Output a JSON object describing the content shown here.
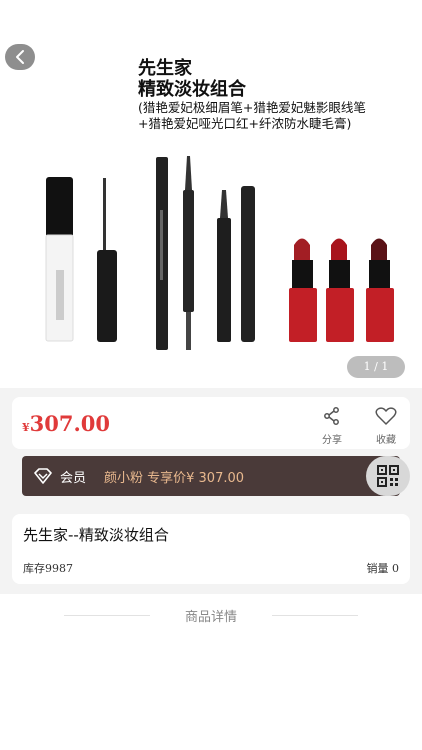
{
  "hero": {
    "title_line1": "先生家",
    "title_line2": "精致淡妆组合",
    "subtitle_line1": "(猎艳爱妃极细眉笔+猎艳爱妃魅影眼线笔",
    "subtitle_line2": "+猎艳爱妃哑光口红+纤浓防水睫毛膏)",
    "pager": "1 / 1"
  },
  "price": {
    "currency": "¥",
    "value": "307.00",
    "share_label": "分享",
    "favorite_label": "收藏"
  },
  "member": {
    "label": "会员",
    "price_text": "颜小粉 专享价¥ 307.00"
  },
  "product": {
    "title": "先生家--精致淡妆组合",
    "stock": "库存9987",
    "sales": "销量 0"
  },
  "details_title": "商品详情",
  "colors": {
    "price_red": "#e03a3a",
    "member_bg": "#4a3a39",
    "member_gold": "#e8b88e",
    "lipstick_red": "#c21f26"
  }
}
